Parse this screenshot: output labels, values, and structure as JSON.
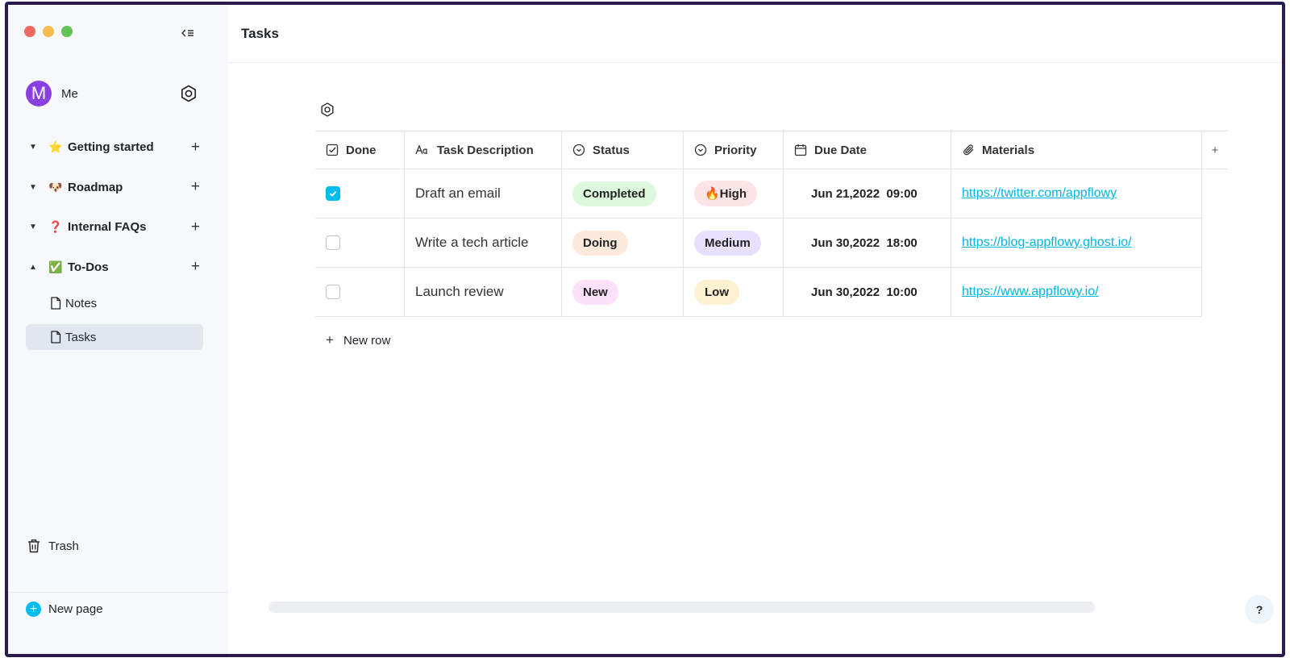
{
  "window": {
    "traffic_lights": [
      "close",
      "minimize",
      "zoom"
    ]
  },
  "user": {
    "initial": "M",
    "name": "Me",
    "avatar_color": "#8a3fe0"
  },
  "sidebar": {
    "items": [
      {
        "emoji": "⭐",
        "label": "Getting started",
        "expanded": false
      },
      {
        "emoji": "🐶",
        "label": "Roadmap",
        "expanded": false
      },
      {
        "emoji": "❓",
        "label": "Internal FAQs",
        "expanded": false
      },
      {
        "emoji": "✅",
        "label": "To-Dos",
        "expanded": true
      }
    ],
    "children": [
      {
        "label": "Notes",
        "active": false
      },
      {
        "label": "Tasks",
        "active": true
      }
    ],
    "trash_label": "Trash",
    "new_page_label": "New page"
  },
  "page": {
    "title": "Tasks"
  },
  "grid": {
    "columns": [
      {
        "icon": "checkbox-icon",
        "label": "Done"
      },
      {
        "icon": "text-icon",
        "label": "Task Description"
      },
      {
        "icon": "select-icon",
        "label": "Status"
      },
      {
        "icon": "select-icon",
        "label": "Priority"
      },
      {
        "icon": "calendar-icon",
        "label": "Due Date"
      },
      {
        "icon": "paperclip-icon",
        "label": "Materials"
      }
    ],
    "rows": [
      {
        "done": true,
        "description": "Draft an email",
        "status": "Completed",
        "priority": "🔥High",
        "due": "Jun 21,2022  09:00",
        "materials": "https://twitter.com/appflowy"
      },
      {
        "done": false,
        "description": "Write a tech article",
        "status": "Doing",
        "priority": "Medium",
        "due": "Jun 30,2022  18:00",
        "materials": "https://blog-appflowy.ghost.io/"
      },
      {
        "done": false,
        "description": "Launch review",
        "status": "New",
        "priority": "Low",
        "due": "Jun 30,2022  10:00",
        "materials": "https://www.appflowy.io/"
      }
    ],
    "new_row_label": "New row"
  },
  "colors": {
    "accent": "#00bcf0",
    "status": {
      "Completed": "#dcf8dd",
      "Doing": "#fde9dc",
      "New": "#fde0fa"
    },
    "priority": {
      "High": "#fde4e6",
      "Medium": "#e8e0ff",
      "Low": "#fdf1d2"
    }
  },
  "help_label": "?"
}
